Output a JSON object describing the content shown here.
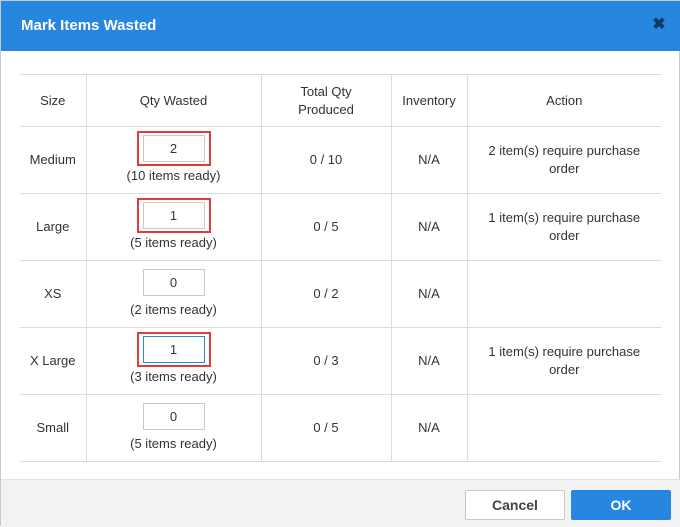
{
  "dialog": {
    "title": "Mark Items Wasted",
    "close_glyph": "✖"
  },
  "columns": {
    "size": "Size",
    "qty_wasted": "Qty Wasted",
    "total_qty": "Total Qty Produced",
    "inventory": "Inventory",
    "action": "Action"
  },
  "rows": [
    {
      "size": "Medium",
      "qty": "2",
      "ready": "(10 items ready)",
      "produced": "0 / 10",
      "inventory": "N/A",
      "action": "2 item(s) require purchase order",
      "highlighted": true
    },
    {
      "size": "Large",
      "qty": "1",
      "ready": "(5 items ready)",
      "produced": "0 / 5",
      "inventory": "N/A",
      "action": "1 item(s) require purchase order",
      "highlighted": true
    },
    {
      "size": "XS",
      "qty": "0",
      "ready": "(2 items ready)",
      "produced": "0 / 2",
      "inventory": "N/A",
      "action": "",
      "highlighted": false
    },
    {
      "size": "X Large",
      "qty": "1",
      "ready": "(3 items ready)",
      "produced": "0 / 3",
      "inventory": "N/A",
      "action": "1 item(s) require purchase order",
      "highlighted": true,
      "focused": true
    },
    {
      "size": "Small",
      "qty": "0",
      "ready": "(5 items ready)",
      "produced": "0 / 5",
      "inventory": "N/A",
      "action": "",
      "highlighted": false
    }
  ],
  "footer": {
    "cancel_label": "Cancel",
    "ok_label": "OK"
  },
  "colors": {
    "header": "#2787e0",
    "highlight": "#e23b3b",
    "ok_button": "#2787e0"
  }
}
